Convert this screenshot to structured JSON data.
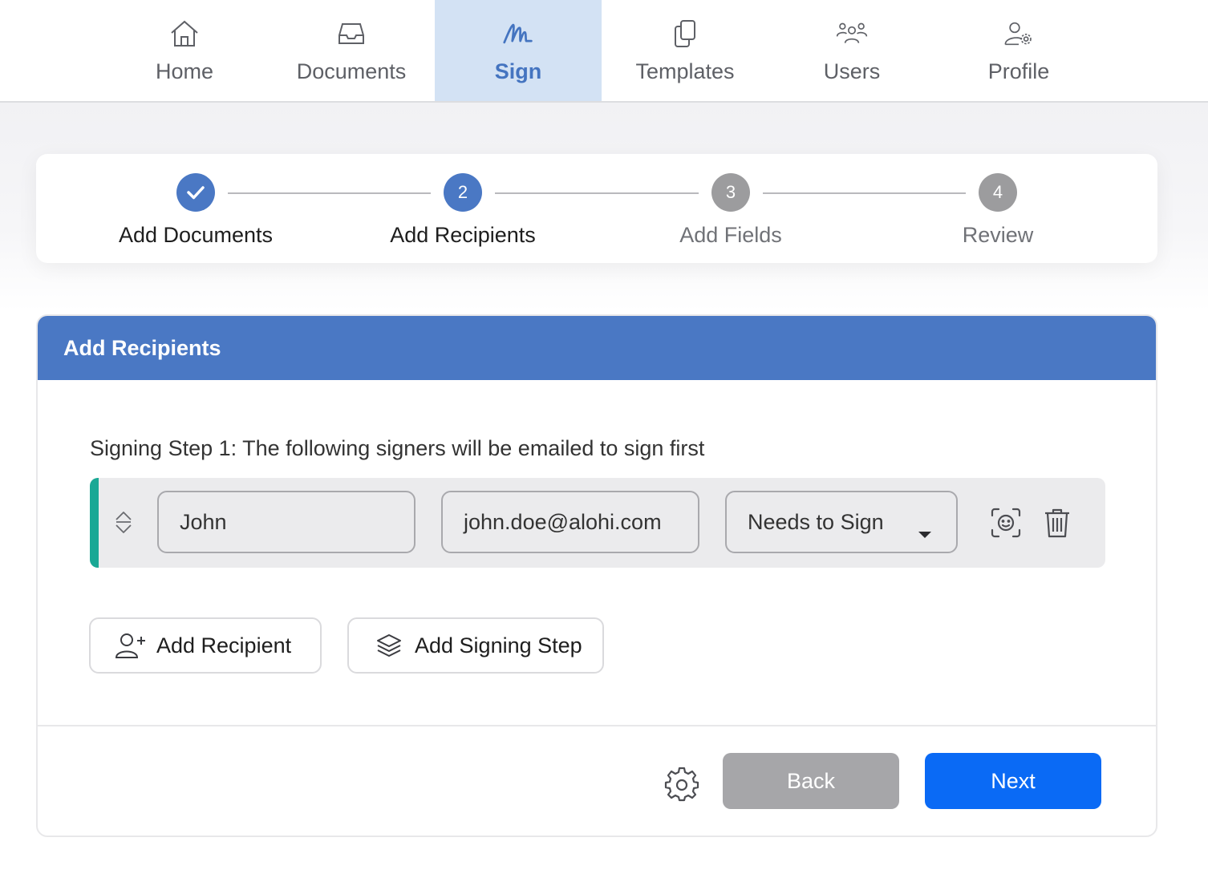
{
  "nav": {
    "items": [
      {
        "label": "Home",
        "icon": "home-icon",
        "active": false
      },
      {
        "label": "Documents",
        "icon": "inbox-icon",
        "active": false
      },
      {
        "label": "Sign",
        "icon": "signature-icon",
        "active": true
      },
      {
        "label": "Templates",
        "icon": "copy-icon",
        "active": false
      },
      {
        "label": "Users",
        "icon": "users-icon",
        "active": false
      },
      {
        "label": "Profile",
        "icon": "user-settings-icon",
        "active": false
      }
    ]
  },
  "stepper": {
    "steps": [
      {
        "number": "1",
        "label": "Add Documents",
        "state": "completed"
      },
      {
        "number": "2",
        "label": "Add Recipients",
        "state": "current"
      },
      {
        "number": "3",
        "label": "Add Fields",
        "state": "pending"
      },
      {
        "number": "4",
        "label": "Review",
        "state": "pending"
      }
    ]
  },
  "panel": {
    "title": "Add Recipients",
    "step_caption": "Signing Step 1: The following signers will be emailed to sign first",
    "recipient": {
      "name": "John",
      "email": "john.doe@alohi.com",
      "role": "Needs to Sign"
    },
    "add_recipient_label": "Add Recipient",
    "add_signing_step_label": "Add Signing Step",
    "back_label": "Back",
    "next_label": "Next"
  },
  "colors": {
    "accent": "#4a78c4",
    "active_tab_bg": "#d3e2f4",
    "primary_button": "#0a6af5",
    "disabled_button": "#a6a6a9",
    "row_accent": "#1aa895"
  }
}
